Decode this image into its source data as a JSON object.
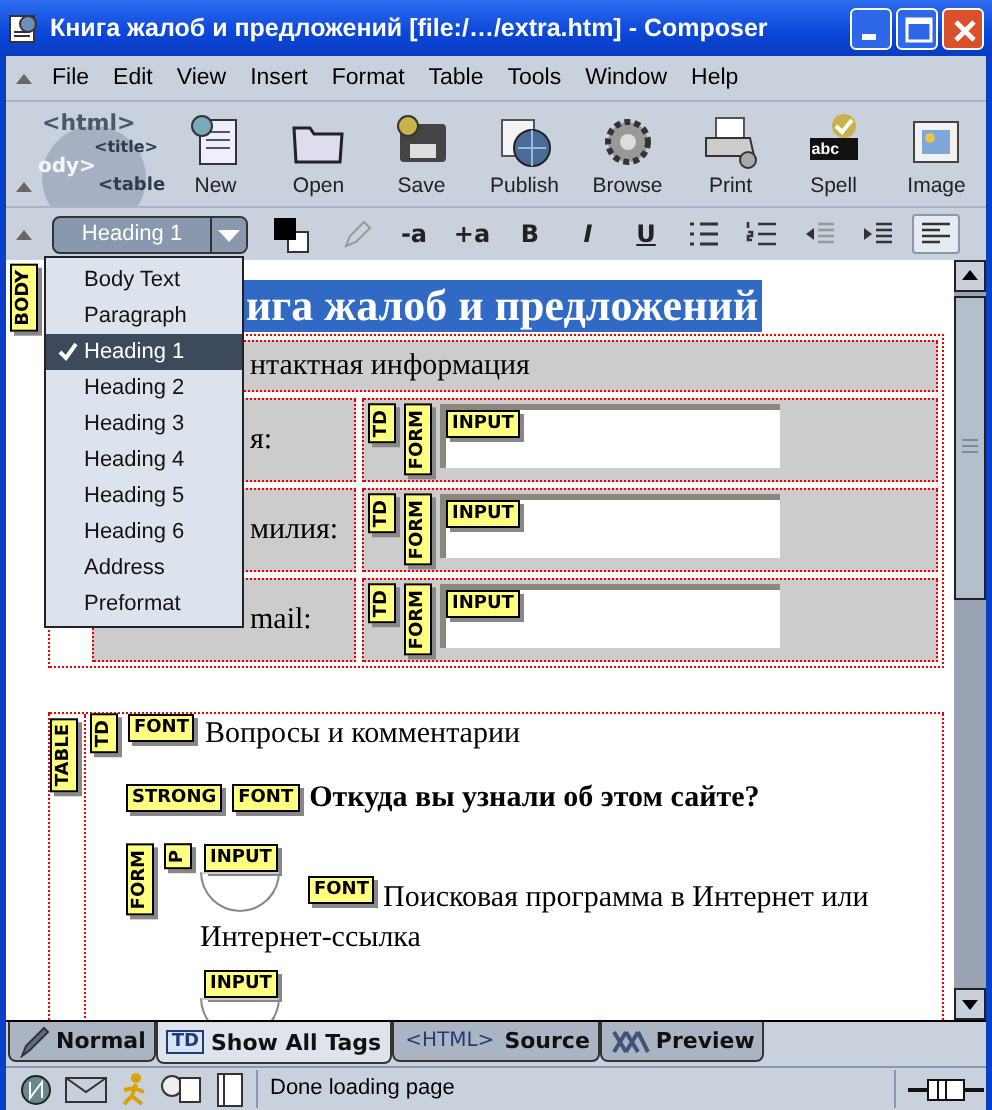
{
  "window": {
    "title": "Книга жалоб и предложений [file:/…/extra.htm] - Composer"
  },
  "menu": [
    "File",
    "Edit",
    "View",
    "Insert",
    "Format",
    "Table",
    "Tools",
    "Window",
    "Help"
  ],
  "logo_texts": [
    "<html>",
    "<title>",
    "ody>",
    "<table"
  ],
  "toolbar": [
    {
      "label": "New",
      "kind": "new"
    },
    {
      "label": "Open",
      "kind": "open"
    },
    {
      "label": "Save",
      "kind": "save"
    },
    {
      "label": "Publish",
      "kind": "publish"
    },
    {
      "label": "Browse",
      "kind": "browse"
    },
    {
      "label": "Print",
      "kind": "print"
    },
    {
      "label": "Spell",
      "kind": "spell",
      "badge": "abc"
    },
    {
      "label": "Image",
      "kind": "image"
    }
  ],
  "paragraph_style": "Heading 1",
  "format_buttons": [
    {
      "kind": "color",
      "on": false
    },
    {
      "kind": "pencil",
      "on": false
    },
    {
      "kind": "text",
      "label": "-a",
      "on": false
    },
    {
      "kind": "text",
      "label": "+a",
      "on": false
    },
    {
      "kind": "text",
      "label": "B",
      "on": false
    },
    {
      "kind": "text",
      "label": "I",
      "on": false
    },
    {
      "kind": "text",
      "label": "U",
      "on": false
    },
    {
      "kind": "bullets",
      "on": false
    },
    {
      "kind": "numbers",
      "on": false
    },
    {
      "kind": "outdent",
      "on": false
    },
    {
      "kind": "indent",
      "on": false
    },
    {
      "kind": "align",
      "on": true
    }
  ],
  "style_menu": [
    {
      "label": "Body Text",
      "selected": false
    },
    {
      "label": "Paragraph",
      "selected": false
    },
    {
      "label": "Heading 1",
      "selected": true
    },
    {
      "label": "Heading 2",
      "selected": false
    },
    {
      "label": "Heading 3",
      "selected": false
    },
    {
      "label": "Heading 4",
      "selected": false
    },
    {
      "label": "Heading 5",
      "selected": false
    },
    {
      "label": "Heading 6",
      "selected": false
    },
    {
      "label": "Address",
      "selected": false
    },
    {
      "label": "Preformat",
      "selected": false
    }
  ],
  "document": {
    "body_tag": "BODY",
    "heading": {
      "text": "ига жалоб и предложений",
      "selected": true
    },
    "contact_table": {
      "header": "нтактная информация",
      "rows": [
        {
          "label": "я:",
          "td_tag": "TD",
          "form_tag": "FORM",
          "input_tag": "INPUT"
        },
        {
          "label": "милия:",
          "td_tag": "TD",
          "form_tag": "FORM",
          "input_tag": "INPUT"
        },
        {
          "label": "mail:",
          "td_tag": "TD",
          "form_tag": "FORM",
          "input_tag": "INPUT"
        }
      ]
    },
    "questions_table": {
      "table_tag": "TABLE",
      "td_tag": "TD",
      "font_tag": "FONT",
      "title": "Вопросы и комментарии",
      "question_tags": [
        "STRONG",
        "FONT"
      ],
      "question": "Откуда вы узнали об этом сайте?",
      "form_tags": [
        "FORM",
        "P"
      ],
      "options": [
        {
          "input_tag": "INPUT",
          "checked": false,
          "font_tag": "FONT",
          "text_lines": [
            "Поисковая программа в Интернет или",
            "Интернет-ссылка"
          ]
        },
        {
          "input_tag": "INPUT",
          "checked": false
        }
      ]
    }
  },
  "view_tabs": [
    {
      "label": "Normal",
      "kind": "normal",
      "selected": false
    },
    {
      "label": "Show All Tags",
      "kind": "tags",
      "badge": "TD",
      "selected": true
    },
    {
      "label": "Source",
      "kind": "source",
      "badge": "<HTML>",
      "selected": false
    },
    {
      "label": "Preview",
      "kind": "preview",
      "selected": false
    }
  ],
  "status_bar": {
    "text": "Done loading page"
  }
}
